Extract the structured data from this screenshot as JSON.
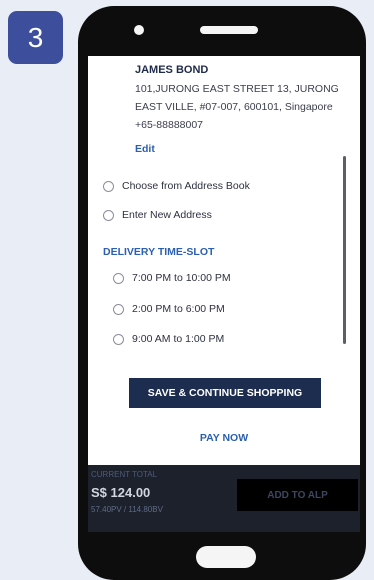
{
  "step": {
    "number": "3"
  },
  "address": {
    "name": "JAMES BOND",
    "line1": "101,JURONG EAST STREET 13, JURONG",
    "line2": "EAST VILLE, #07-007, 600101, Singapore",
    "phone": "+65-88888007",
    "edit_label": "Edit"
  },
  "address_options": [
    {
      "label": "Choose from Address Book"
    },
    {
      "label": "Enter New Address"
    }
  ],
  "delivery": {
    "title": "DELIVERY TIME-SLOT",
    "slots": [
      {
        "label": "7:00 PM to 10:00 PM"
      },
      {
        "label": "2:00 PM to 6:00 PM"
      },
      {
        "label": "9:00 AM to 1:00 PM"
      }
    ]
  },
  "actions": {
    "save_label": "SAVE & CONTINUE SHOPPING",
    "pay_label": "PAY NOW"
  },
  "footer": {
    "total_label": "CURRENT TOTAL",
    "total_value": "S$ 124.00",
    "points": "57.40PV / 114.80BV",
    "add_label": "ADD TO ALP"
  },
  "colors": {
    "badge": "#3d4e9c",
    "accent": "#2b5fb1",
    "button": "#1c2d4f",
    "background": "#e9edf6"
  }
}
